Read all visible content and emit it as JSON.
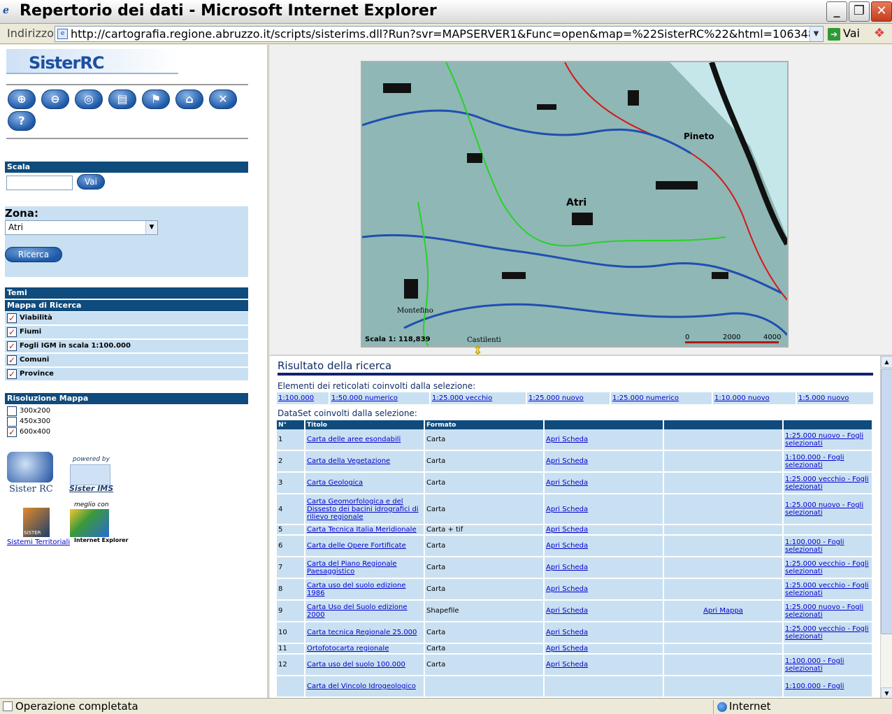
{
  "window": {
    "title": "Repertorio dei dati - Microsoft Internet Explorer",
    "minimize": "_",
    "maximize": "❐",
    "close": "✕"
  },
  "addressbar": {
    "label": "Indirizzo",
    "url": "http://cartografia.regione.abruzzo.it/scripts/sisterims.dll?Run?svr=MAPSERVER1&Func=open&map=%22SisterRC%22&html=1063485772406",
    "go_label": "Vai"
  },
  "left": {
    "logo": "SisterRC",
    "tools": [
      {
        "icon": "zoom-in-icon",
        "glyph": "🔍+"
      },
      {
        "icon": "zoom-out-icon",
        "glyph": "🔍−"
      },
      {
        "icon": "target-icon",
        "glyph": "◎"
      },
      {
        "icon": "document-icon",
        "glyph": "▤"
      },
      {
        "icon": "flag-icon",
        "glyph": "⚑"
      },
      {
        "icon": "home-icon",
        "glyph": "⌂"
      },
      {
        "icon": "tools-icon",
        "glyph": "✂"
      },
      {
        "icon": "help-icon",
        "glyph": "?"
      }
    ],
    "scala_label": "Scala",
    "scala_value": "",
    "scala_button": "Vai",
    "zona_label": "Zona:",
    "zona_selected": "Atri",
    "ricerca_button": "Ricerca",
    "temi_label": "Temi",
    "mappa_label": "Mappa di Ricerca",
    "layers": [
      {
        "label": "Viabilità",
        "checked": true
      },
      {
        "label": "Fiumi",
        "checked": true
      },
      {
        "label": "Fogli IGM in scala 1:100.000",
        "checked": true
      },
      {
        "label": "Comuni",
        "checked": true
      },
      {
        "label": "Province",
        "checked": true
      }
    ],
    "risoluzione_label": "Risoluzione Mappa",
    "resolutions": [
      {
        "label": "300x200",
        "checked": false
      },
      {
        "label": "450x300",
        "checked": false
      },
      {
        "label": "600x400",
        "checked": true
      }
    ],
    "brand_sister_rc": "Sister RC",
    "brand_powered_by": "powered by",
    "brand_sister_ims": "Sister IMS",
    "brand_meglio_con": "meglio con",
    "brand_sistemi": "Sistemi Territoriali",
    "brand_ie": "Internet Explorer",
    "brand_sister": "SISTER"
  },
  "map": {
    "scale_text": "Scala 1: 118,839",
    "scalebar_0": "0",
    "scalebar_mid": "2000",
    "scalebar_max": "4000",
    "place_pineto": "Pineto",
    "place_atri": "Atri",
    "place_montefino": "Montefino",
    "place_castilenti": "Castilenti"
  },
  "results": {
    "title": "Risultato della ricerca",
    "elementi_label": "Elementi dei reticolati coinvolti dalla selezione:",
    "scale_links": [
      "1:100.000",
      "1:50.000 numerico",
      "1:25.000 vecchio",
      "1:25.000 nuovo",
      "1:25.000 numerico",
      "1:10.000 nuovo",
      "1:5.000 nuovo"
    ],
    "dataset_label": "DataSet coinvolti dalla selezione:",
    "headers": [
      "N°",
      "Titolo",
      "Formato",
      "",
      "",
      ""
    ],
    "rows": [
      {
        "n": "1",
        "titolo": "Carta delle aree esondabili",
        "formato": "Carta",
        "scheda": "Apri Scheda",
        "mappa": "",
        "fogli": "1:25.000 nuovo - Fogli selezionati"
      },
      {
        "n": "2",
        "titolo": "Carta della Vegetazione",
        "formato": "Carta",
        "scheda": "Apri Scheda",
        "mappa": "",
        "fogli": "1:100.000 - Fogli selezionati"
      },
      {
        "n": "3",
        "titolo": "Carta Geologica",
        "formato": "Carta",
        "scheda": "Apri Scheda",
        "mappa": "",
        "fogli": "1:25.000 vecchio - Fogli selezionati"
      },
      {
        "n": "4",
        "titolo": "Carta Geomorfologica e del Dissesto dei bacini idrografici di rilievo regionale",
        "formato": "Carta",
        "scheda": "Apri Scheda",
        "mappa": "",
        "fogli": "1:25.000 nuovo - Fogli selezionati"
      },
      {
        "n": "5",
        "titolo": "Carta Tecnica Italia Meridionale",
        "formato": "Carta + tif",
        "scheda": "Apri Scheda",
        "mappa": "",
        "fogli": ""
      },
      {
        "n": "6",
        "titolo": "Carta delle Opere Fortificate",
        "formato": "Carta",
        "scheda": "Apri Scheda",
        "mappa": "",
        "fogli": "1:100.000 - Fogli selezionati"
      },
      {
        "n": "7",
        "titolo": "Carta del Piano Regionale Paesaggistico",
        "formato": "Carta",
        "scheda": "Apri Scheda",
        "mappa": "",
        "fogli": "1:25.000 vecchio - Fogli selezionati"
      },
      {
        "n": "8",
        "titolo": "Carta uso del suolo edizione 1986",
        "formato": "Carta",
        "scheda": "Apri Scheda",
        "mappa": "",
        "fogli": "1:25.000 vecchio - Fogli selezionati"
      },
      {
        "n": "9",
        "titolo": "Carta Uso del Suolo edizione 2000",
        "formato": "Shapefile",
        "scheda": "Apri Scheda",
        "mappa": "Apri Mappa",
        "fogli": "1:25.000 nuovo - Fogli selezionati"
      },
      {
        "n": "10",
        "titolo": "Carta tecnica Regionale 25.000",
        "formato": "Carta",
        "scheda": "Apri Scheda",
        "mappa": "",
        "fogli": "1:25.000 vecchio - Fogli selezionati"
      },
      {
        "n": "11",
        "titolo": "Ortofotocarta regionale",
        "formato": "Carta",
        "scheda": "Apri Scheda",
        "mappa": "",
        "fogli": ""
      },
      {
        "n": "12",
        "titolo": "Carta uso del suolo 100.000",
        "formato": "Carta",
        "scheda": "Apri Scheda",
        "mappa": "",
        "fogli": "1:100.000 - Fogli selezionati"
      },
      {
        "n": "",
        "titolo": "Carta del Vincolo Idrogeologico",
        "formato": "",
        "scheda": "",
        "mappa": "",
        "fogli": "1:100.000 - Fogli"
      }
    ]
  },
  "status": {
    "text": "Operazione completata",
    "zone": "Internet"
  }
}
